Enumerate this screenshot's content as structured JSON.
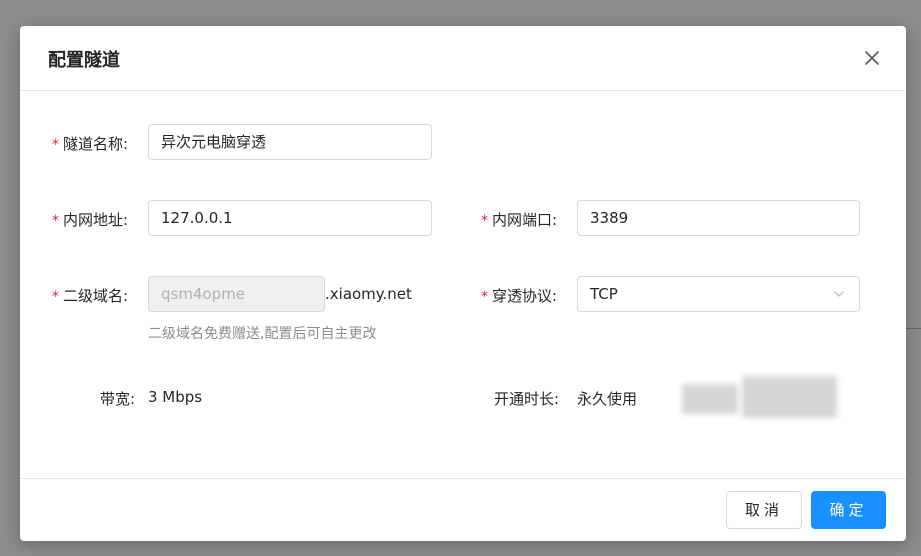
{
  "dialog": {
    "title": "配置隧道"
  },
  "form": {
    "tunnel_name": {
      "label": "隧道名称:",
      "value": "异次元电脑穿透"
    },
    "local_address": {
      "label": "内网地址:",
      "value": "127.0.0.1"
    },
    "local_port": {
      "label": "内网端口:",
      "value": "3389"
    },
    "subdomain": {
      "label": "二级域名:",
      "value": "qsm4opme",
      "suffix": ".xiaomy.net",
      "hint": "二级域名免费赠送,配置后可自主更改"
    },
    "protocol": {
      "label": "穿透协议:",
      "value": "TCP"
    },
    "bandwidth": {
      "label": "带宽:",
      "value": "3 Mbps"
    },
    "duration": {
      "label": "开通时长:",
      "value": "永久使用"
    }
  },
  "footer": {
    "cancel_label": "取消",
    "ok_label": "确定"
  },
  "colors": {
    "primary": "#1890ff",
    "required": "#f5222d"
  },
  "icons": {
    "close": "close-icon",
    "select_arrow": "chevron-down-icon"
  }
}
